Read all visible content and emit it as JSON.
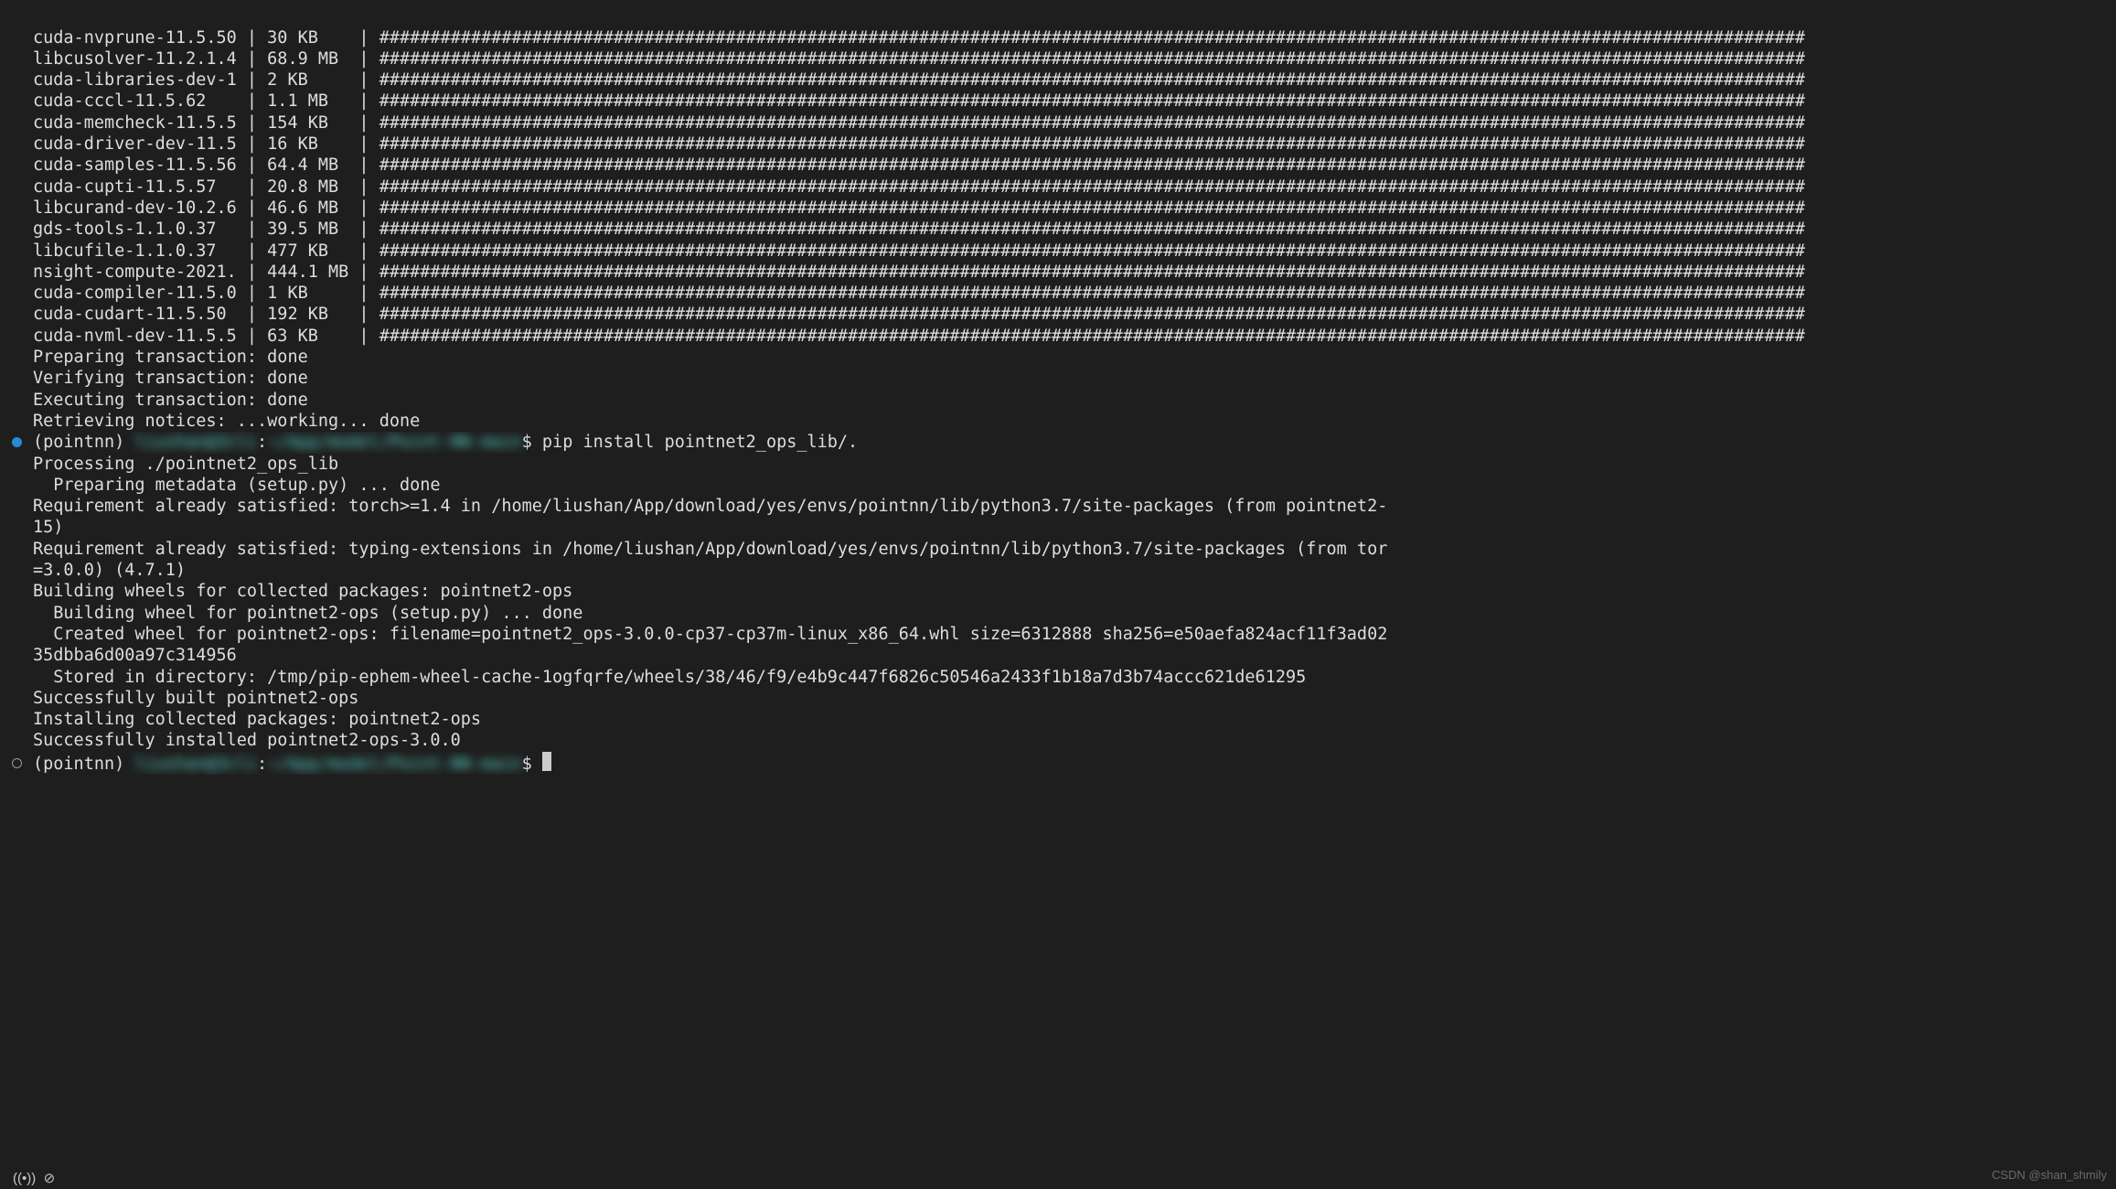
{
  "downloads": [
    {
      "name": "cuda-nvprune-11.5.50",
      "size": "30 KB"
    },
    {
      "name": "libcusolver-11.2.1.4",
      "size": "68.9 MB"
    },
    {
      "name": "cuda-libraries-dev-1",
      "size": "2 KB"
    },
    {
      "name": "cuda-cccl-11.5.62",
      "size": "1.1 MB"
    },
    {
      "name": "cuda-memcheck-11.5.5",
      "size": "154 KB"
    },
    {
      "name": "cuda-driver-dev-11.5",
      "size": "16 KB"
    },
    {
      "name": "cuda-samples-11.5.56",
      "size": "64.4 MB"
    },
    {
      "name": "cuda-cupti-11.5.57",
      "size": "20.8 MB"
    },
    {
      "name": "libcurand-dev-10.2.6",
      "size": "46.6 MB"
    },
    {
      "name": "gds-tools-1.1.0.37",
      "size": "39.5 MB"
    },
    {
      "name": "libcufile-1.1.0.37",
      "size": "477 KB"
    },
    {
      "name": "nsight-compute-2021.",
      "size": "444.1 MB"
    },
    {
      "name": "cuda-compiler-11.5.0",
      "size": "1 KB"
    },
    {
      "name": "cuda-cudart-11.5.50",
      "size": "192 KB"
    },
    {
      "name": "cuda-nvml-dev-11.5.5",
      "size": "63 KB"
    }
  ],
  "tx": {
    "preparing": "Preparing transaction: done",
    "verifying": "Verifying transaction: done",
    "executing": "Executing transaction: done",
    "retrieving": "Retrieving notices: ...working... done"
  },
  "prompt1": {
    "env": "(pointnn) ",
    "redacted1": "liushan@3cli",
    "redacted2": "~/App/model/Point-NN-main",
    "dollar": "$ ",
    "cmd": "pip install pointnet2_ops_lib/."
  },
  "pip": {
    "processing": "Processing ./pointnet2_ops_lib",
    "preparing": "  Preparing metadata (setup.py) ... done",
    "req1": "Requirement already satisfied: torch>=1.4 in /home/liushan/App/download/yes/envs/pointnn/lib/python3.7/site-packages (from pointnet2-",
    "req1b": "15)",
    "req2": "Requirement already satisfied: typing-extensions in /home/liushan/App/download/yes/envs/pointnn/lib/python3.7/site-packages (from tor",
    "req2b": "=3.0.0) (4.7.1)",
    "buildingHeader": "Building wheels for collected packages: pointnet2-ops",
    "buildingWheel": "  Building wheel for pointnet2-ops (setup.py) ... done",
    "createdWheel": "  Created wheel for pointnet2-ops: filename=pointnet2_ops-3.0.0-cp37-cp37m-linux_x86_64.whl size=6312888 sha256=e50aefa824acf11f3ad02",
    "createdWheel2": "35dbba6d00a97c314956",
    "storedIn": "  Stored in directory: /tmp/pip-ephem-wheel-cache-1ogfqrfe/wheels/38/46/f9/e4b9c447f6826c50546a2433f1b18a7d3b74accc621de61295",
    "successBuilt": "Successfully built pointnet2-ops",
    "installing": "Installing collected packages: pointnet2-ops",
    "successInstalled": "Successfully installed pointnet2-ops-3.0.0"
  },
  "prompt2": {
    "env": "(pointnn) ",
    "redacted1": "liushan@3cli",
    "redacted2": "~/App/model/Point-NN-main",
    "dollar": "$ "
  },
  "watermark": "CSDN @shan_shmily"
}
